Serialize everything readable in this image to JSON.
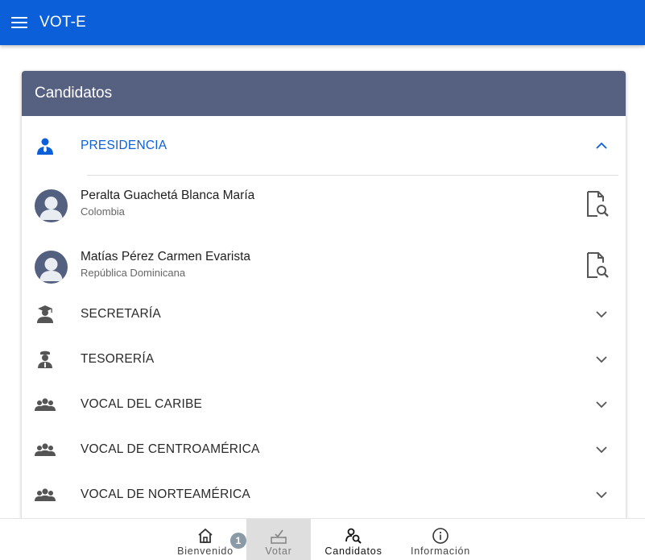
{
  "app": {
    "title": "VOT-E"
  },
  "card": {
    "title": "Candidatos"
  },
  "sections": [
    {
      "label": "PRESIDENCIA",
      "icon": "person-tie-icon",
      "expanded": true
    },
    {
      "label": "SECRETARÍA",
      "icon": "graduate-icon",
      "expanded": false
    },
    {
      "label": "TESORERÍA",
      "icon": "officer-icon",
      "expanded": false
    },
    {
      "label": "VOCAL DEL CARIBE",
      "icon": "group-icon",
      "expanded": false
    },
    {
      "label": "VOCAL DE CENTROAMÉRICA",
      "icon": "group-icon",
      "expanded": false
    },
    {
      "label": "VOCAL DE NORTEAMÉRICA",
      "icon": "group-icon",
      "expanded": false
    }
  ],
  "candidates": [
    {
      "name": "Peralta Guachetá Blanca María",
      "country": "Colombia",
      "action_icon": "document-search-icon"
    },
    {
      "name": "Matías Pérez Carmen Evarista",
      "country": "República Dominicana",
      "action_icon": "document-search-icon"
    }
  ],
  "bottom_nav": {
    "items": [
      {
        "label": "Bienvenido",
        "icon": "home-icon"
      },
      {
        "label": "Votar",
        "icon": "ballot-box-icon"
      },
      {
        "label": "Candidatos",
        "icon": "person-search-icon"
      },
      {
        "label": "Información",
        "icon": "info-icon"
      }
    ],
    "badge": "1"
  },
  "colors": {
    "app_bar": "#0b5fd9",
    "card_header": "#566182",
    "active_section": "#0b5fd9",
    "avatar": "#536080"
  }
}
